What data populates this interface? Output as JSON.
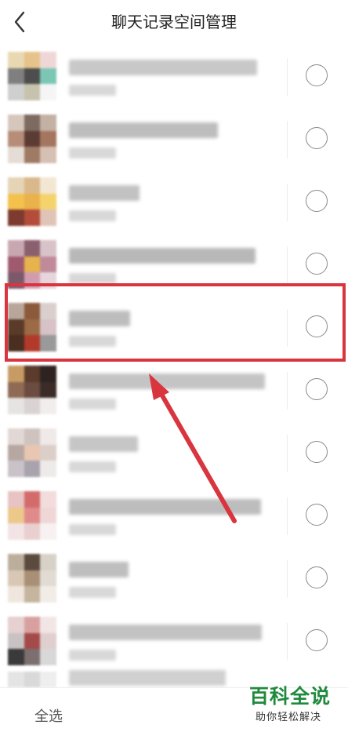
{
  "header": {
    "title": "聊天记录空间管理",
    "back_icon": "chevron-left-icon"
  },
  "footer": {
    "select_all_label": "全选"
  },
  "watermark": {
    "main": "百科全说",
    "sub": "助你轻松解决"
  },
  "colors": {
    "highlight": "#d9353f",
    "watermark": "#1f8a3c"
  },
  "conversations": [
    {
      "name": "",
      "selected": false
    },
    {
      "name": "",
      "selected": false
    },
    {
      "name": "",
      "selected": false
    },
    {
      "name": "",
      "selected": false
    },
    {
      "name": "",
      "selected": false
    },
    {
      "name": "",
      "selected": false
    },
    {
      "name": "",
      "selected": false
    },
    {
      "name": "",
      "selected": false
    },
    {
      "name": "",
      "selected": false
    },
    {
      "name": "",
      "selected": false
    },
    {
      "name": "",
      "selected": false
    }
  ]
}
